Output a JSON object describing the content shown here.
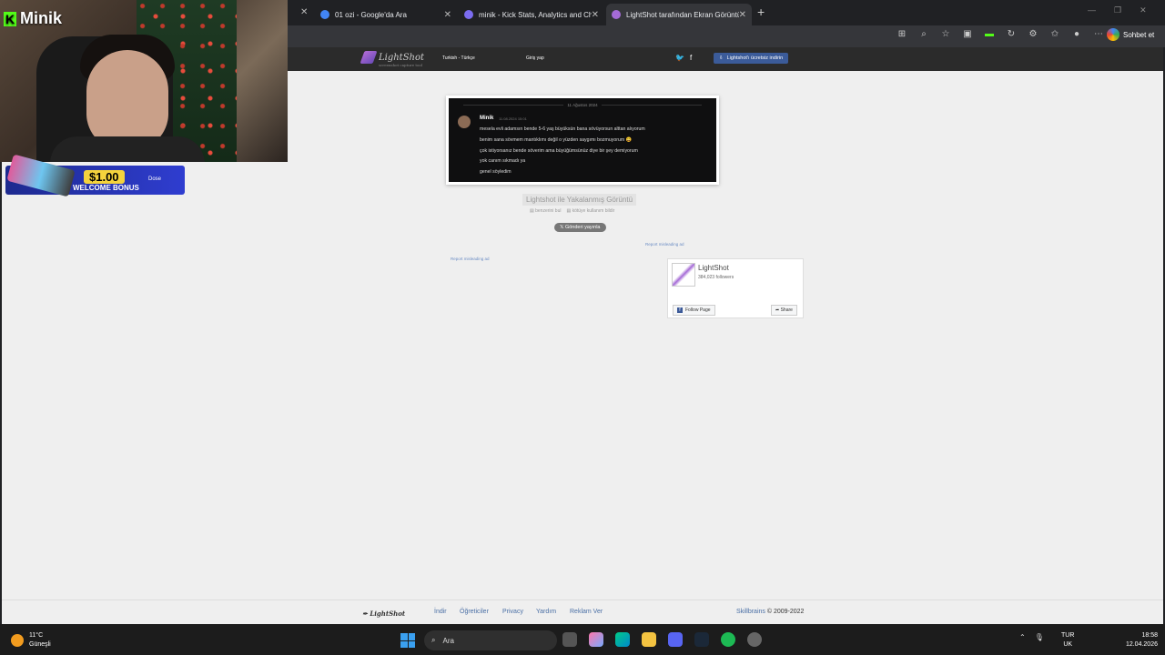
{
  "overlay": {
    "streamer_name": "Minik",
    "promo_amount": "$1.00",
    "promo_label": "WELCOME BONUS",
    "promo_brand": "Dose"
  },
  "browser": {
    "tabs": [
      {
        "title": "01 ozi - Google'da Ara",
        "favicon_color": "#4285f4"
      },
      {
        "title": "minik - Kick Stats, Analytics and Ch",
        "favicon_color": "#7b6cf0"
      },
      {
        "title": "LightShot tarafından Ekran Görüntü",
        "favicon_color": "#a56bd6",
        "active": true
      }
    ],
    "chat_button": "Sohbet et"
  },
  "header": {
    "logo": "LightShot",
    "logo_sub": "screenshot capture tool",
    "language": "Turkish - Türkçe",
    "login": "Giriş yap",
    "download_button": "Lightshot'ı ücretsiz indirin"
  },
  "screenshot": {
    "date_divider": "11 Ağustos 2024",
    "username": "Minik",
    "timestamp": "11.08.2024 15:01",
    "lines": [
      "mesela evli adamsın bende 5-6 yaş büyüksün bana sövüyorsun alttan alıyorum",
      "benim sana sövmem mantıklımı değil o yüzden saygımı bozmuyorum 😄",
      "çok istiyorsanız bende söverim ama büyüğümsünüz diye bir şey demiyorum",
      "yok canım sıkmadı ya",
      "genel söyledim"
    ]
  },
  "page": {
    "caption": "Lightshot ile Yakalanmış Görüntü",
    "similar_link": "benzerini bul",
    "report_abuse_link": "kötüye kullanım bildir",
    "publish_button": "Gönderi yayınla",
    "report_ad_1": "Report misleading ad",
    "report_ad_2": "Report misleading ad"
  },
  "facebook_widget": {
    "name": "LightShot",
    "followers": "384,023 followers",
    "follow_button": "Follow Page",
    "share_button": "Share"
  },
  "footer": {
    "logo": "LightShot",
    "links": [
      "İndir",
      "Öğreticiler",
      "Privacy",
      "Yardım",
      "Reklam Ver"
    ],
    "company": "Skillbrains",
    "copyright": "© 2009-2022"
  },
  "taskbar": {
    "temperature": "11°C",
    "condition": "Güneşli",
    "search_placeholder": "Ara",
    "lang_line1": "TUR",
    "lang_line2": "UK",
    "time": "18:58",
    "date": "12.04.2026"
  }
}
